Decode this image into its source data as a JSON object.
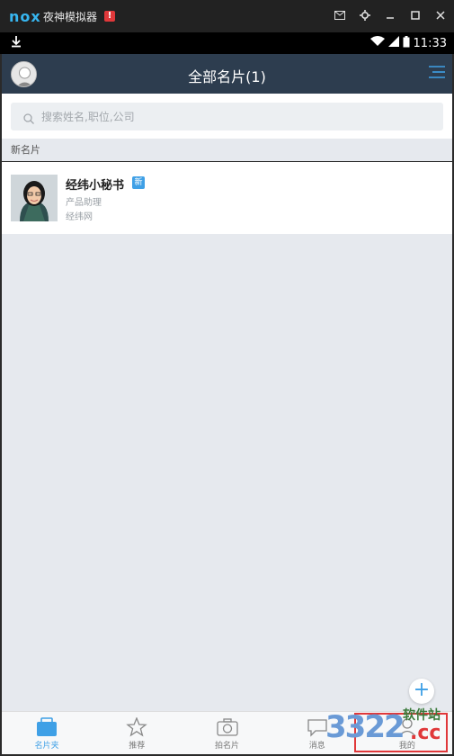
{
  "emulator": {
    "logo": "nox",
    "title": "夜神模拟器",
    "alert": "!"
  },
  "status_bar": {
    "time": "11:33"
  },
  "header": {
    "title": "全部名片(1)"
  },
  "search": {
    "placeholder": "搜索姓名,职位,公司"
  },
  "section": {
    "label": "新名片"
  },
  "card": {
    "name": "经纬小秘书",
    "badge": "新",
    "role": "产品助理",
    "company": "经纬网"
  },
  "nav": {
    "items": [
      {
        "label": "名片夹",
        "icon": "cardholder-icon",
        "active": true
      },
      {
        "label": "推荐",
        "icon": "star-icon",
        "active": false
      },
      {
        "label": "拍名片",
        "icon": "camera-icon",
        "active": false
      },
      {
        "label": "消息",
        "icon": "message-icon",
        "active": false
      },
      {
        "label": "我的",
        "icon": "user-icon",
        "active": false
      }
    ]
  },
  "watermark": {
    "number": "3322",
    "domain": ".cc",
    "site": "软件站"
  },
  "colors": {
    "header_bg": "#2d3d4f",
    "accent": "#3fa0e6",
    "page_bg": "#e6e9ee"
  }
}
